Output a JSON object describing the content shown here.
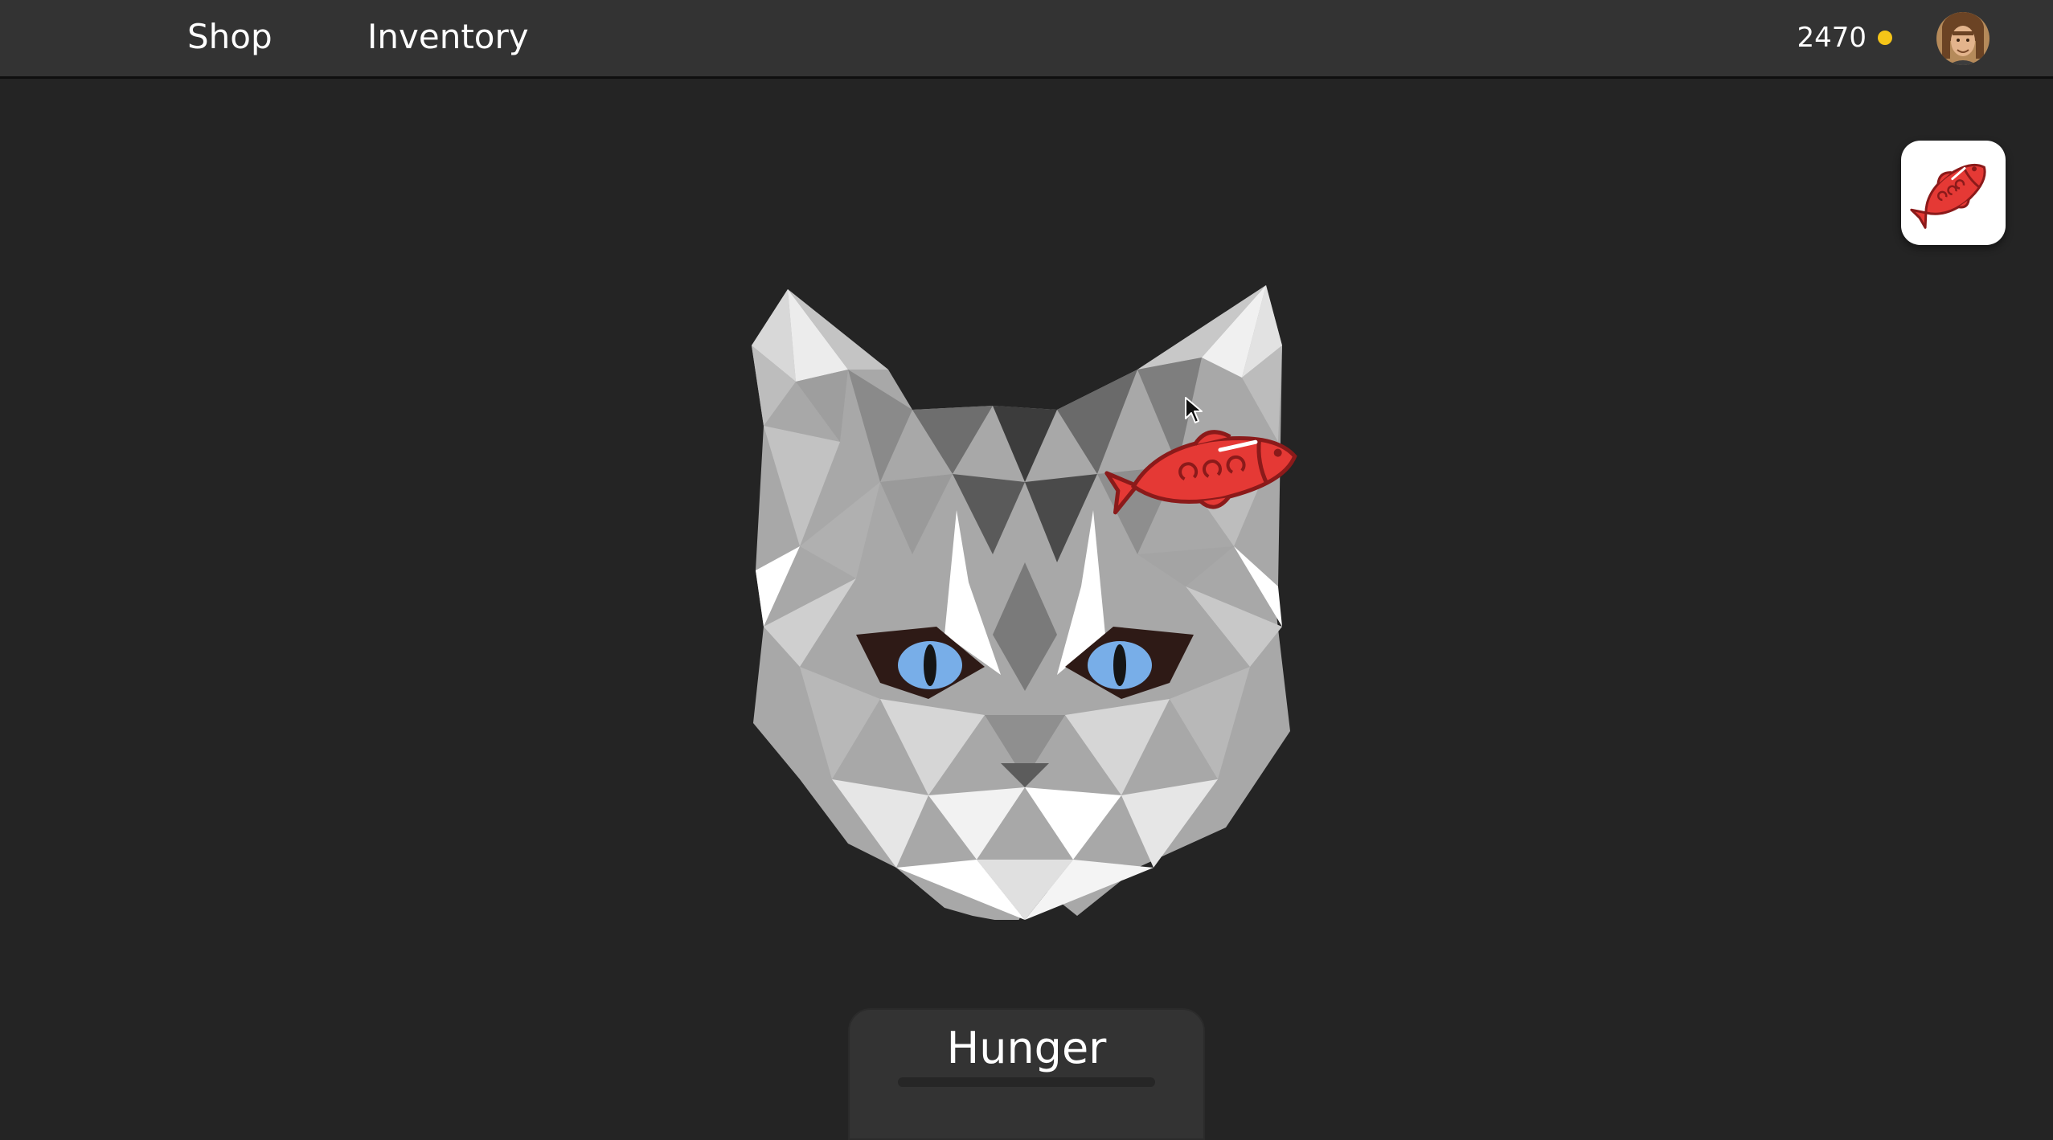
{
  "nav": {
    "shop_label": "Shop",
    "inventory_label": "Inventory"
  },
  "wallet": {
    "coins": "2470",
    "coin_color": "#f5c518"
  },
  "user": {
    "avatar": "avatar"
  },
  "equipped_item": {
    "icon": "fish-icon",
    "color": "#e53935"
  },
  "pet": {
    "image": "low-poly-cat-head",
    "eye_color": "#78aee8"
  },
  "dragging_item": {
    "icon": "fish-icon"
  },
  "hunger": {
    "label": "Hunger",
    "value": 0
  }
}
